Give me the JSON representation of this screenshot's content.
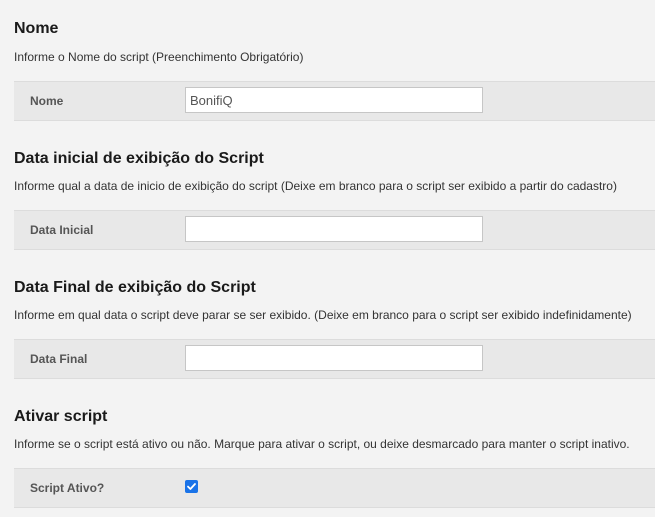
{
  "sections": [
    {
      "title": "Nome",
      "description": "Informe o Nome do script (Preenchimento Obrigatório)",
      "field_label": "Nome",
      "field_value": "BonifiQ",
      "field_placeholder": ""
    },
    {
      "title": "Data inicial de exibição do Script",
      "description": "Informe qual a data de inicio de exibição do script (Deixe em branco para o script ser exibido a partir do cadastro)",
      "field_label": "Data Inicial",
      "field_value": "",
      "field_placeholder": ""
    },
    {
      "title": "Data Final de exibição do Script",
      "description": "Informe em qual data o script deve parar se ser exibido. (Deixe em branco para o script ser exibido indefinidamente)",
      "field_label": "Data Final",
      "field_value": "",
      "field_placeholder": ""
    },
    {
      "title": "Ativar script",
      "description": "Informe se o script está ativo ou não. Marque para ativar o script, ou deixe desmarcado para manter o script inativo.",
      "field_label": "Script Ativo?",
      "checked": true
    }
  ],
  "colors": {
    "page_background": "#f3f3f3",
    "row_background": "#e8e8e8",
    "checkbox_accent": "#1a73e8"
  }
}
